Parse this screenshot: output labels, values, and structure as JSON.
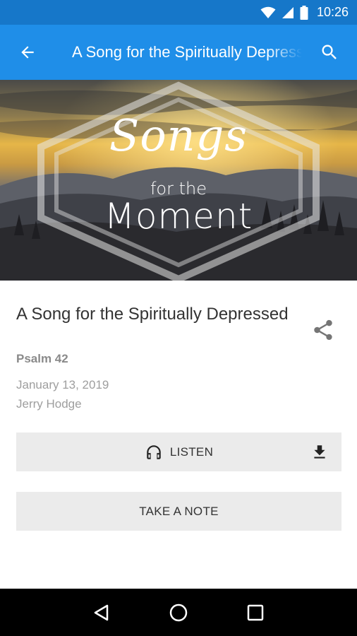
{
  "status_bar": {
    "time": "10:26",
    "icons": [
      "wifi-icon",
      "cell-signal-icon",
      "battery-icon"
    ]
  },
  "app_bar": {
    "title": "A Song for the Spiritually Depressed",
    "back_icon": "arrow-left-icon",
    "search_icon": "search-icon",
    "background": "#1f8ee8",
    "status_background": "#1677c9"
  },
  "hero": {
    "line1": "Songs",
    "line2": "for the",
    "line3": "Moment"
  },
  "sermon": {
    "title": "A Song for the Spiritually Depressed",
    "passage": "Psalm 42",
    "date": "January 13, 2019",
    "speaker": "Jerry Hodge"
  },
  "actions": {
    "listen_label": "LISTEN",
    "take_note_label": "TAKE A NOTE",
    "share_icon": "share-icon",
    "download_icon": "download-icon",
    "headphones_icon": "headphones-icon"
  },
  "nav_bar": {
    "icons": [
      "back-triangle-icon",
      "home-circle-icon",
      "recents-square-icon"
    ]
  }
}
